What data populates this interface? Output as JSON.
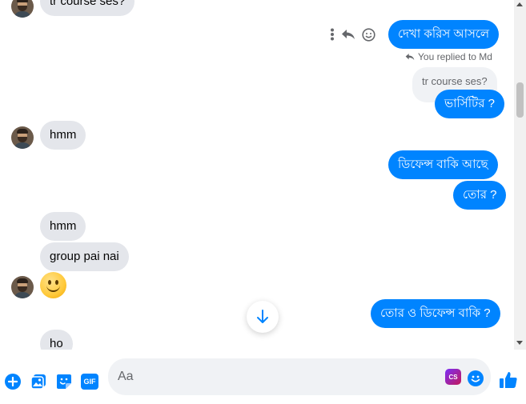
{
  "messages": {
    "top_partial": "tr course ses?",
    "out_1": "দেখা করিস আসলে",
    "replied_note": "You replied to Md",
    "quoted": "tr course ses?",
    "out_2": "ভার্সিটির ?",
    "in_1": "hmm",
    "out_3": "ডিফেন্স বাকি আছে",
    "out_4": "তোর ?",
    "in_2": "hmm",
    "in_3": "group pai nai",
    "out_5": "তোর ও ডিফেন্স বাকি ?",
    "in_4": "ho"
  },
  "composer": {
    "placeholder": "Aa",
    "cs_badge": "CS",
    "gif_label": "GIF"
  },
  "colors": {
    "accent": "#0084ff",
    "incoming_bubble": "#e4e6eb",
    "composer_bg": "#f0f2f5"
  },
  "icons": [
    "more-icon",
    "reply-icon",
    "react-icon",
    "arrow-down-icon",
    "plus-icon",
    "image-icon",
    "sticker-icon",
    "gif-icon",
    "emoji-icon",
    "like-icon"
  ]
}
